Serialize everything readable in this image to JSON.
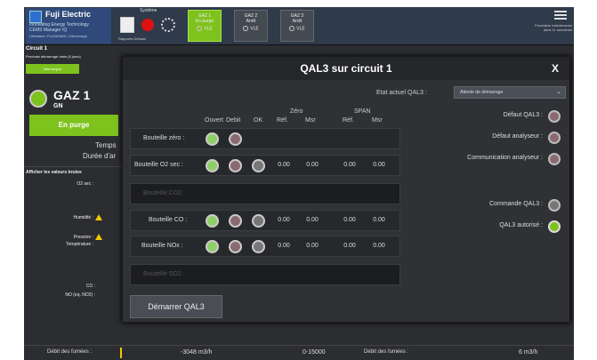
{
  "brand": {
    "name": "Fuji Electric",
    "tagline": "Innovating Energy Technology",
    "product": "CEMS Manager IQ",
    "status_line": "Utilisateur: FUJIADMIN • Démarrage"
  },
  "system": {
    "label": "Système",
    "sub": "Rapports  Défauts"
  },
  "gas_tabs": [
    {
      "name": "GAZ 1",
      "state": "En purge",
      "mode": "VLE"
    },
    {
      "name": "GAZ 2",
      "state": "Arrêt",
      "mode": "VLE"
    },
    {
      "name": "GAZ 3",
      "state": "Arrêt",
      "mode": "VLE"
    }
  ],
  "topright": {
    "text": "Prochaine maintenance dans 11 semaines"
  },
  "left": {
    "circuit_title": "Circuit 1",
    "circuit_info": "Prochain démarrage dans (8 jours)",
    "circuit_button": "Interrompre",
    "gaz_name": "GAZ 1",
    "gaz_sub": "GN",
    "purge_label": "En purge",
    "temps_label": "Temps",
    "duree_label": "Durée d'ar",
    "raw_title": "Afficher les valeurs brutes",
    "o2_label": "O2 sec :",
    "humidite_label": "Humidité :",
    "pression_label": "Pression :",
    "temperature_label": "Température :",
    "co_label": "CO :",
    "no_label": "NO (eq. NO2) :"
  },
  "bottom": {
    "debit_label": "Débit des fumées :",
    "debit_value": "-3048 m3/h",
    "range": "0-15000",
    "debit_label_2": "Débit des fumées :",
    "debit_value_2": "6 m3/h"
  },
  "modal": {
    "title": "QAL3 sur circuit 1",
    "close": "X",
    "state_label": "Etat actuel QAL3 :",
    "state_value": "Attente de démarrage",
    "headers": {
      "ouvert": "Ouvert",
      "debit": "Debit",
      "ok": "OK",
      "zero": "Zéro",
      "span": "SPAN",
      "ref1": "Réf.",
      "msr1": "Msr",
      "ref2": "Réf.",
      "msr2": "Msr"
    },
    "rows": [
      {
        "label": "Bouteille zéro :",
        "enabled": true
      },
      {
        "label": "Bouteille O2 sec :",
        "enabled": true,
        "values": [
          "0.00",
          "0.00",
          "0.00",
          "0.00"
        ]
      },
      {
        "label": "Bouteille CO2 :",
        "enabled": false
      },
      {
        "label": "Bouteille CO :",
        "enabled": true,
        "values": [
          "0.00",
          "0.00",
          "0.00",
          "0.00"
        ]
      },
      {
        "label": "Bouteille NOx :",
        "enabled": true,
        "values": [
          "0.00",
          "0.00",
          "0.00",
          "0.00"
        ]
      },
      {
        "label": "Bouteille SO2 :",
        "enabled": false
      }
    ],
    "status": {
      "defaut_qal3": "Défaut QAL3 :",
      "defaut_analyseur": "Défaut analyseur :",
      "communication": "Communication analyseur :",
      "commande": "Commande QAL3 :",
      "autorise": "QAL3 autorisé :"
    },
    "start_button": "Démarrer QAL3"
  }
}
